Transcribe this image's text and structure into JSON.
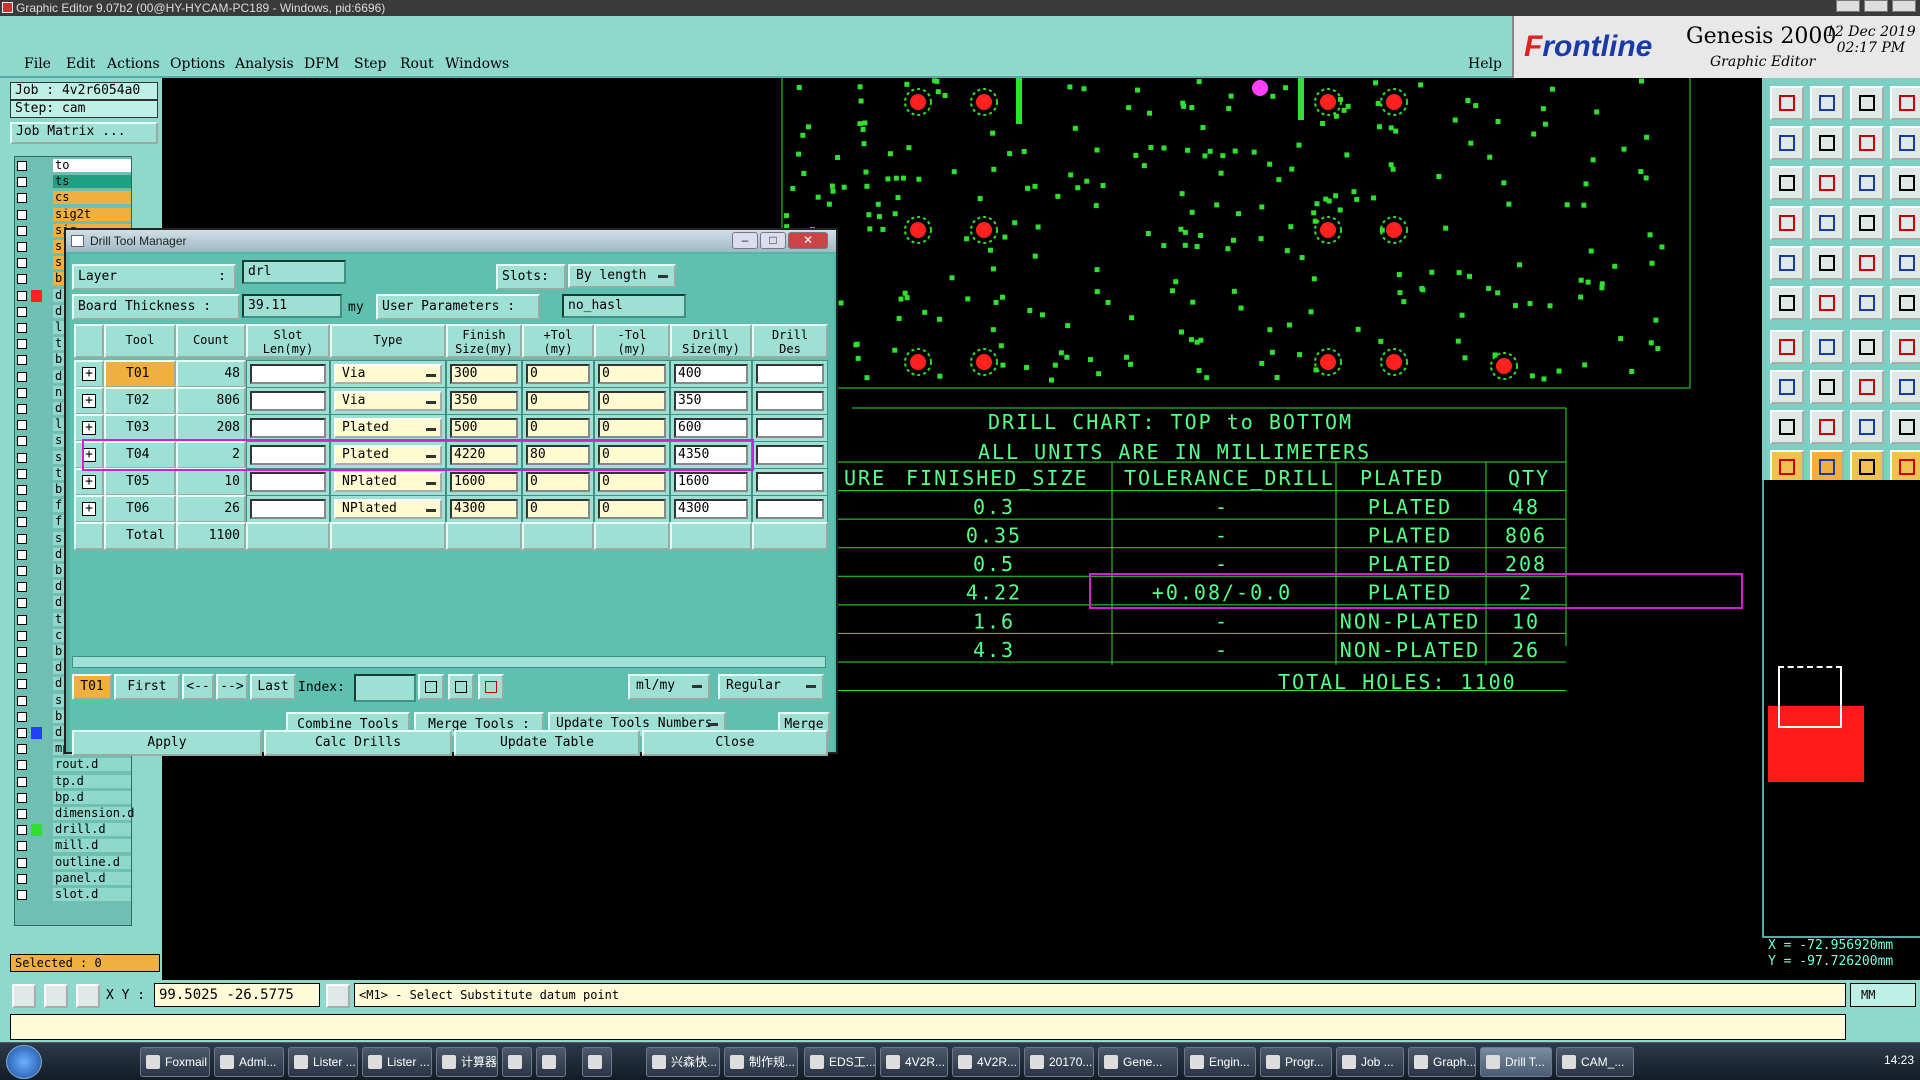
{
  "window": {
    "title": "Graphic Editor 9.07b2 (00@HY-HYCAM-PC189 - Windows, pid:6696)"
  },
  "menu": {
    "items": [
      "File",
      "Edit",
      "Actions",
      "Options",
      "Analysis",
      "DFM",
      "Step",
      "Rout",
      "Windows"
    ],
    "help": "Help"
  },
  "brand": {
    "logo_f": "F",
    "logo_rest": "rontline",
    "product": "Genesis 2000",
    "subtitle": "Graphic Editor",
    "date": "12 Dec 2019",
    "time": "02:17 PM"
  },
  "left": {
    "job": "Job : 4v2r6054a0",
    "step": "Step: cam",
    "job_matrix": "Job Matrix ...",
    "selected": "Selected : 0",
    "layers": [
      {
        "name": "to",
        "color": "#ffffff",
        "swatch": ""
      },
      {
        "name": "ts",
        "color": "#20a080",
        "swatch": ""
      },
      {
        "name": "cs",
        "color": "#f0b040",
        "swatch": ""
      },
      {
        "name": "sig2t",
        "color": "#f0b040",
        "swatch": ""
      },
      {
        "name": "sig",
        "color": "#f0b040",
        "swatch": ""
      },
      {
        "name": "s",
        "color": "#f0b040",
        "swatch": ""
      },
      {
        "name": "s",
        "color": "#f0b040",
        "swatch": ""
      },
      {
        "name": "b",
        "color": "#f0b040",
        "swatch": ""
      },
      {
        "name": "d",
        "color": "#8ed8cc",
        "swatch": "#ff2020"
      },
      {
        "name": "d",
        "color": "#8ed8cc",
        "swatch": ""
      },
      {
        "name": "l",
        "color": "#8ed8cc",
        "swatch": ""
      },
      {
        "name": "t",
        "color": "#8ed8cc",
        "swatch": ""
      },
      {
        "name": "b",
        "color": "#8ed8cc",
        "swatch": ""
      },
      {
        "name": "d",
        "color": "#8ed8cc",
        "swatch": ""
      },
      {
        "name": "n",
        "color": "#8ed8cc",
        "swatch": ""
      },
      {
        "name": "d",
        "color": "#8ed8cc",
        "swatch": ""
      },
      {
        "name": "l",
        "color": "#8ed8cc",
        "swatch": ""
      },
      {
        "name": "s",
        "color": "#8ed8cc",
        "swatch": ""
      },
      {
        "name": "s",
        "color": "#8ed8cc",
        "swatch": ""
      },
      {
        "name": "t",
        "color": "#8ed8cc",
        "swatch": ""
      },
      {
        "name": "b",
        "color": "#8ed8cc",
        "swatch": ""
      },
      {
        "name": "f",
        "color": "#8ed8cc",
        "swatch": ""
      },
      {
        "name": "f",
        "color": "#8ed8cc",
        "swatch": ""
      },
      {
        "name": "s",
        "color": "#8ed8cc",
        "swatch": ""
      },
      {
        "name": "d",
        "color": "#8ed8cc",
        "swatch": ""
      },
      {
        "name": "b",
        "color": "#8ed8cc",
        "swatch": ""
      },
      {
        "name": "d",
        "color": "#8ed8cc",
        "swatch": ""
      },
      {
        "name": "d",
        "color": "#8ed8cc",
        "swatch": ""
      },
      {
        "name": "t",
        "color": "#8ed8cc",
        "swatch": ""
      },
      {
        "name": "c",
        "color": "#8ed8cc",
        "swatch": ""
      },
      {
        "name": "b",
        "color": "#8ed8cc",
        "swatch": ""
      },
      {
        "name": "d",
        "color": "#8ed8cc",
        "swatch": ""
      },
      {
        "name": "d",
        "color": "#8ed8cc",
        "swatch": ""
      },
      {
        "name": "s",
        "color": "#8ed8cc",
        "swatch": ""
      },
      {
        "name": "b",
        "color": "#8ed8cc",
        "swatch": ""
      },
      {
        "name": "d",
        "color": "#8ed8cc",
        "swatch": "#2040ff"
      },
      {
        "name": "mpdrl.d",
        "color": "#8ed8cc",
        "swatch": ""
      },
      {
        "name": "rout.d",
        "color": "#8ed8cc",
        "swatch": ""
      },
      {
        "name": "tp.d",
        "color": "#8ed8cc",
        "swatch": ""
      },
      {
        "name": "bp.d",
        "color": "#8ed8cc",
        "swatch": ""
      },
      {
        "name": "dimension.d",
        "color": "#8ed8cc",
        "swatch": ""
      },
      {
        "name": "drill.d",
        "color": "#8ed8cc",
        "swatch": "#30e030"
      },
      {
        "name": "mill.d",
        "color": "#8ed8cc",
        "swatch": ""
      },
      {
        "name": "outline.d",
        "color": "#8ed8cc",
        "swatch": ""
      },
      {
        "name": "panel.d",
        "color": "#8ed8cc",
        "swatch": ""
      },
      {
        "name": "slot.d",
        "color": "#8ed8cc",
        "swatch": ""
      }
    ]
  },
  "dialog": {
    "title": "Drill Tool Manager",
    "layer_label": "Layer",
    "layer_sep": ":",
    "layer_value": "drl",
    "slots_label": "Slots:",
    "slots_value": "By length",
    "thickness_label": "Board Thickness :",
    "thickness_value": "39.11",
    "thickness_unit": "my",
    "user_params_label": "User Parameters :",
    "user_params_value": "no_hasl",
    "headers": [
      "Tool",
      "Count",
      "Slot\nLen(my)",
      "Type",
      "Finish\nSize(my)",
      "+Tol\n(my)",
      "-Tol\n(my)",
      "Drill\nSize(my)",
      "Drill\nDes"
    ],
    "rows": [
      {
        "tool": "T01",
        "count": "48",
        "slot": "",
        "type": "Via",
        "finish": "300",
        "ptol": "0",
        "ntol": "0",
        "drill": "400",
        "des": ""
      },
      {
        "tool": "T02",
        "count": "806",
        "slot": "",
        "type": "Via",
        "finish": "350",
        "ptol": "0",
        "ntol": "0",
        "drill": "350",
        "des": ""
      },
      {
        "tool": "T03",
        "count": "208",
        "slot": "",
        "type": "Plated",
        "finish": "500",
        "ptol": "0",
        "ntol": "0",
        "drill": "600",
        "des": ""
      },
      {
        "tool": "T04",
        "count": "2",
        "slot": "",
        "type": "Plated",
        "finish": "4220",
        "ptol": "80",
        "ntol": "0",
        "drill": "4350",
        "des": ""
      },
      {
        "tool": "T05",
        "count": "10",
        "slot": "",
        "type": "NPlated",
        "finish": "1600",
        "ptol": "0",
        "ntol": "0",
        "drill": "1600",
        "des": ""
      },
      {
        "tool": "T06",
        "count": "26",
        "slot": "",
        "type": "NPlated",
        "finish": "4300",
        "ptol": "0",
        "ntol": "0",
        "drill": "4300",
        "des": ""
      }
    ],
    "total_label": "Total",
    "total_value": "1100",
    "nav": {
      "current": "T01",
      "first": "First",
      "prev": "<--",
      "next": "-->",
      "last": "Last",
      "index_label": "Index:",
      "units": "ml/my",
      "mode": "Regular"
    },
    "buttons": {
      "combine": "Combine Tools",
      "merge_tools": "Merge Tools :",
      "update_numbers": "Update Tools Numbers",
      "merge": "Merge",
      "apply": "Apply",
      "calc": "Calc Drills",
      "update_table": "Update Table",
      "close": "Close"
    }
  },
  "drill_chart": {
    "title": "DRILL CHART: TOP to BOTTOM",
    "units": "ALL UNITS ARE IN MILLIMETERS",
    "headers": [
      "URE",
      "FINISHED_SIZE",
      "TOLERANCE_DRILL",
      "PLATED",
      "QTY"
    ],
    "rows": [
      [
        "0.3",
        "-",
        "PLATED",
        "48"
      ],
      [
        "0.35",
        "-",
        "PLATED",
        "806"
      ],
      [
        "0.5",
        "-",
        "PLATED",
        "208"
      ],
      [
        "4.22",
        "+0.08/-0.0",
        "PLATED",
        "2"
      ],
      [
        "1.6",
        "-",
        "NON-PLATED",
        "10"
      ],
      [
        "4.3",
        "-",
        "NON-PLATED",
        "26"
      ]
    ],
    "total": "TOTAL HOLES:  1100"
  },
  "coords": {
    "x": "X = -72.956920mm",
    "y": "Y = -97.726200mm"
  },
  "status": {
    "xy_label": "X Y :",
    "xy_value": "99.5025 -26.5775",
    "prompt": "<M1> - Select Substitute datum point",
    "units": "MM"
  },
  "taskbar": {
    "items": [
      "Foxmail",
      "Admi...",
      "Lister ...",
      "Lister ...",
      "计算器",
      "",
      "",
      "",
      "兴森快...",
      "制作规...",
      "EDS工...",
      "4V2R...",
      "4V2R...",
      "20170...",
      "Gene...",
      "Engin...",
      "Progr...",
      "Job ...",
      "Graph...",
      "Drill T...",
      "CAM_..."
    ],
    "time": "14:23"
  },
  "colors": {
    "teal": "#8ed8cc",
    "pad_red": "#ff2020",
    "trace_green": "#30e030",
    "chart_green": "#55ff88",
    "highlight": "#d020d0",
    "selected_orange": "#f0b040"
  }
}
